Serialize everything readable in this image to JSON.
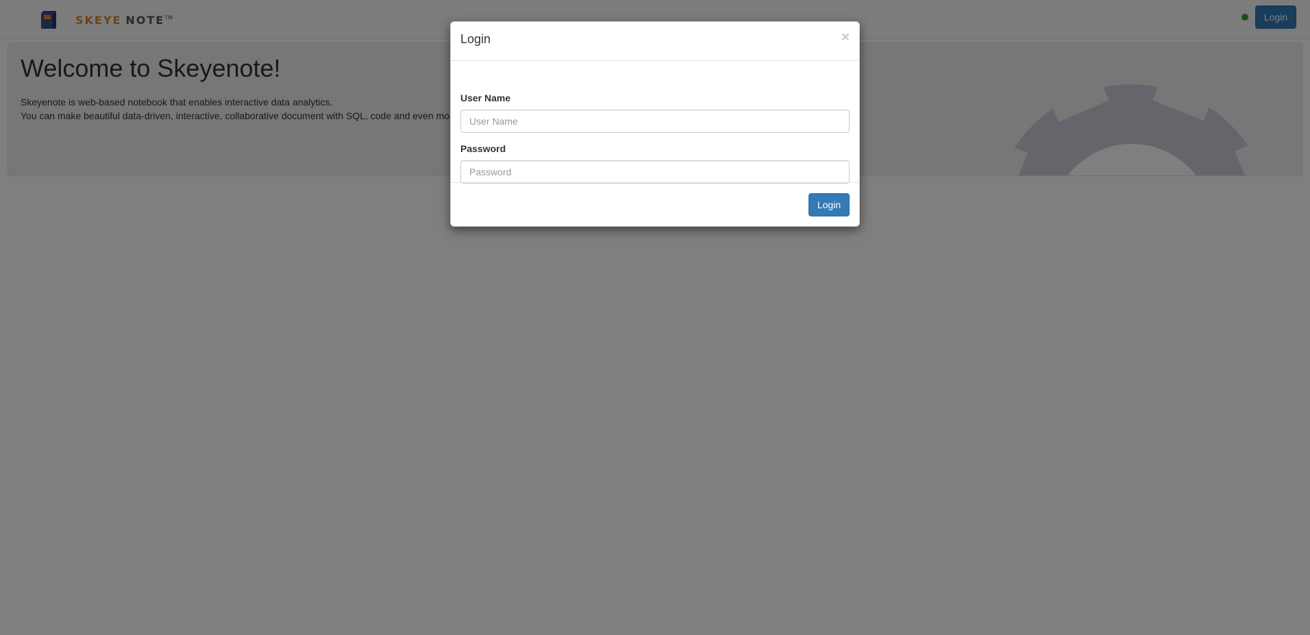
{
  "navbar": {
    "brand": {
      "skeye": "SKEYE",
      "note": "NOTE",
      "tm": "TM"
    },
    "login_label": "Login",
    "status_color": "#2ea02e",
    "icon": "notebook-logo-icon"
  },
  "jumbotron": {
    "title": "Welcome to Skeyenote!",
    "line1": "Skeyenote is web-based notebook that enables interactive data analytics.",
    "line2": "You can make beautiful data-driven, interactive, collaborative document with SQL, code and even mo",
    "icon": "gear-logo-icon"
  },
  "modal": {
    "title": "Login",
    "close_glyph": "×",
    "username": {
      "label": "User Name",
      "placeholder": "User Name",
      "value": ""
    },
    "password": {
      "label": "Password",
      "placeholder": "Password",
      "value": ""
    },
    "submit_label": "Login"
  },
  "colors": {
    "primary": "#337ab7",
    "brand_orange": "#d98a2b",
    "gear_gray": "#9aa6b8"
  }
}
